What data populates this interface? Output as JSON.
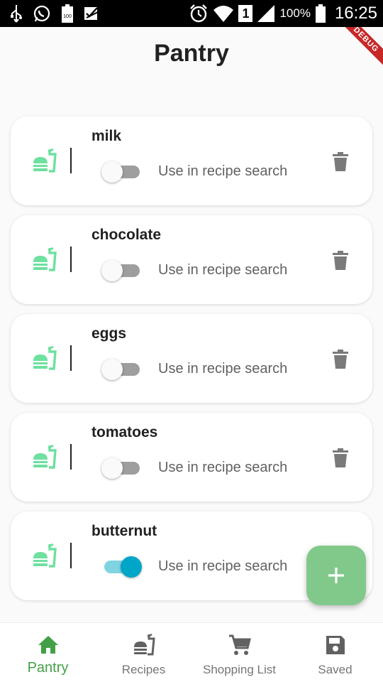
{
  "status_bar": {
    "battery_pct": "100%",
    "time": "16:25",
    "sim_slot": "1"
  },
  "app_bar": {
    "title": "Pantry",
    "debug_banner": "DEBUG"
  },
  "pantry_items": [
    {
      "name": "milk",
      "toggle_label": "Use in recipe search",
      "enabled": false
    },
    {
      "name": "chocolate",
      "toggle_label": "Use in recipe search",
      "enabled": false
    },
    {
      "name": "eggs",
      "toggle_label": "Use in recipe search",
      "enabled": false
    },
    {
      "name": "tomatoes",
      "toggle_label": "Use in recipe search",
      "enabled": false
    },
    {
      "name": "butternut",
      "toggle_label": "Use in recipe search",
      "enabled": true
    }
  ],
  "fab": {
    "icon": "plus-icon",
    "color": "#81c98a"
  },
  "bottom_nav": {
    "items": [
      {
        "label": "Pantry",
        "icon": "home-icon",
        "active": true
      },
      {
        "label": "Recipes",
        "icon": "fastfood-icon",
        "active": false
      },
      {
        "label": "Shopping List",
        "icon": "cart-icon",
        "active": false
      },
      {
        "label": "Saved",
        "icon": "save-icon",
        "active": false
      }
    ]
  },
  "colors": {
    "accent_green": "#43a047",
    "food_icon": "#6ee0a0",
    "toggle_on": "#00a6c8"
  }
}
